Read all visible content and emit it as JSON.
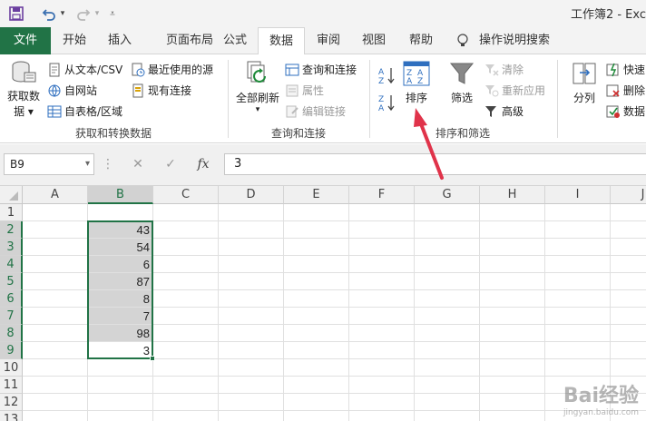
{
  "title": "工作簿2 - Exc",
  "tabs": [
    {
      "label": "文件"
    },
    {
      "label": "开始"
    },
    {
      "label": "插入"
    },
    {
      "label": "页面布局"
    },
    {
      "label": "公式"
    },
    {
      "label": "数据"
    },
    {
      "label": "审阅"
    },
    {
      "label": "视图"
    },
    {
      "label": "帮助"
    },
    {
      "label": "操作说明搜索"
    }
  ],
  "ribbon": {
    "get_data_line1": "获取数",
    "get_data_line2": "据",
    "from_text_csv": "从文本/CSV",
    "from_web": "自网站",
    "from_table": "自表格/区域",
    "recent_sources": "最近使用的源",
    "existing_connections": "现有连接",
    "group_get_transform": "获取和转换数据",
    "refresh_all": "全部刷新",
    "queries_connections": "查询和连接",
    "properties": "属性",
    "edit_links": "编辑链接",
    "group_queries": "查询和连接",
    "sort": "排序",
    "filter": "筛选",
    "clear": "清除",
    "reapply": "重新应用",
    "advanced": "高级",
    "group_sort_filter": "排序和筛选",
    "text_to_columns": "分列",
    "flash_fill": "快速",
    "remove_duplicates": "删除",
    "data_validation": "数据"
  },
  "formula_bar": {
    "name_box": "B9",
    "fx": "fx",
    "value": "3"
  },
  "columns": [
    "A",
    "B",
    "C",
    "D",
    "E",
    "F",
    "G",
    "H",
    "I",
    "J"
  ],
  "rows": [
    "1",
    "2",
    "3",
    "4",
    "5",
    "6",
    "7",
    "8",
    "9",
    "10",
    "11",
    "12",
    "13"
  ],
  "column_b_values": [
    "",
    "43",
    "54",
    "6",
    "87",
    "8",
    "7",
    "98",
    "3",
    "",
    "",
    "",
    ""
  ],
  "watermark": {
    "brand": "Bai经验",
    "url": "jingyan.baidu.com"
  },
  "colors": {
    "accent": "#217346",
    "arrow": "#e0334a"
  }
}
